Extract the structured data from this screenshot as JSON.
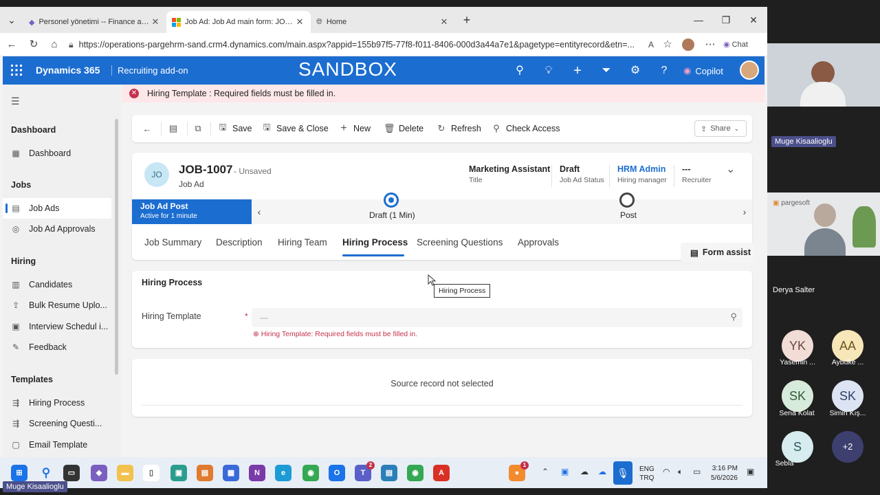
{
  "browser": {
    "tabs": [
      {
        "title": "Personel yönetimi -- Finance and (",
        "active": false
      },
      {
        "title": "Job Ad: Job Ad main form: JOB-10",
        "active": true
      },
      {
        "title": "Home",
        "active": false
      }
    ],
    "url": "https://operations-pargehrm-sand.crm4.dynamics.com/main.aspx?appid=155b97f5-77f8-f011-8406-000d3a44a7e1&pagetype=entityrecord&etn=...",
    "chat_label": "Chat"
  },
  "app": {
    "brand": "Dynamics 365",
    "app_name": "Recruiting add-on",
    "environment_banner": "SANDBOX",
    "copilot_label": "Copilot",
    "brand_color": "#1c6dd0"
  },
  "sidebar": {
    "sections": [
      {
        "header": "Dashboard",
        "items": [
          {
            "label": "Dashboard",
            "icon": "dashboard-icon"
          }
        ]
      },
      {
        "header": "Jobs",
        "items": [
          {
            "label": "Job Ads",
            "icon": "job-ads-icon",
            "selected": true
          },
          {
            "label": "Job Ad Approvals",
            "icon": "approvals-icon"
          }
        ]
      },
      {
        "header": "Hiring",
        "items": [
          {
            "label": "Candidates",
            "icon": "candidates-icon"
          },
          {
            "label": "Bulk Resume Uplo...",
            "icon": "upload-icon"
          },
          {
            "label": "Interview Schedul i...",
            "icon": "calendar-icon"
          },
          {
            "label": "Feedback",
            "icon": "feedback-icon"
          }
        ]
      },
      {
        "header": "Templates",
        "items": [
          {
            "label": "Hiring Process",
            "icon": "process-icon"
          },
          {
            "label": "Screening Questi...",
            "icon": "questions-icon"
          },
          {
            "label": "Email Template",
            "icon": "email-icon"
          }
        ]
      }
    ]
  },
  "notification": {
    "message": "Hiring Template : Required fields must be filled in."
  },
  "commands": {
    "save": "Save",
    "save_close": "Save & Close",
    "new": "New",
    "delete": "Delete",
    "refresh": "Refresh",
    "check_access": "Check Access",
    "share": "Share"
  },
  "record": {
    "initials": "JO",
    "title": "JOB-1007",
    "unsaved": "- Unsaved",
    "entity": "Job Ad",
    "header_fields": [
      {
        "value": "Marketing Assistant",
        "label": "Title",
        "link": false
      },
      {
        "value": "Draft",
        "label": "Job Ad Status",
        "link": false
      },
      {
        "value": "HRM Admin",
        "label": "Hiring manager",
        "link": true
      },
      {
        "value": "---",
        "label": "Recruiter",
        "link": false
      }
    ]
  },
  "process": {
    "active_name": "Job Ad Post",
    "active_duration": "Active for 1 minute",
    "stages": [
      {
        "label": "Draft  (1 Min)",
        "current": true
      },
      {
        "label": "Post",
        "current": false
      }
    ]
  },
  "form_tabs": [
    "Job Summary",
    "Description",
    "Hiring Team",
    "Hiring Process",
    "Screening Questions",
    "Approvals"
  ],
  "active_tab_index": 3,
  "form_assist_label": "Form assist",
  "section": {
    "title": "Hiring Process",
    "field_label": "Hiring Template",
    "required_marker": "*",
    "field_placeholder": "---",
    "field_error": "Hiring Template: Required fields must be filled in."
  },
  "tooltip": "Hiring Process",
  "subgrid": {
    "message": "Source record not selected"
  },
  "taskbar": {
    "lang_line1": "ENG",
    "lang_line2": "TRQ",
    "time": "3:16 PM",
    "date": "5/6/2026"
  },
  "meeting": {
    "participants_video": [
      {
        "name": "Muge Kisaalioglu"
      },
      {
        "name": "Derya Salter"
      }
    ],
    "participants_avatars": [
      {
        "initials": "YK",
        "name": "Yasemin ...",
        "color": "#f1dcd6"
      },
      {
        "initials": "AA",
        "name": "Aybüke ...",
        "color": "#f6e6b8"
      },
      {
        "initials": "SK",
        "name": "Sena Kolat",
        "color": "#d7ebdc"
      },
      {
        "initials": "SK",
        "name": "Simin Kış...",
        "color": "#dce3f2"
      },
      {
        "initials": "S",
        "name": "Sebla",
        "color": "#d6ecef"
      },
      {
        "initials": "+2",
        "name": "",
        "color": "#3d3f6e"
      }
    ],
    "presenter_tag": "Muge Kisaalioglu",
    "logo_text": "pargesoft"
  }
}
